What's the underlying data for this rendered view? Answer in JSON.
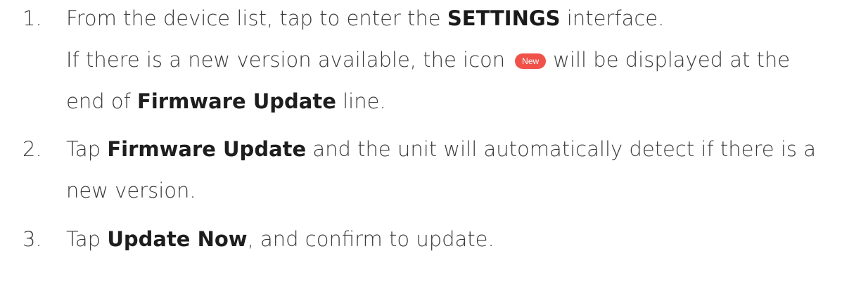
{
  "steps": [
    {
      "number": "1.",
      "lines": {
        "l1": {
          "a": "From the device list, tap to enter the ",
          "kw": "SETTINGS",
          "b": " interface."
        },
        "l2": {
          "a": "If there is a new version available, the icon",
          "badge": "New",
          "b": "will be displayed at the"
        },
        "l3": {
          "a": "end of ",
          "kw": "Firmware Update",
          "b": " line."
        }
      }
    },
    {
      "number": "2.",
      "lines": {
        "l1": {
          "a": "Tap ",
          "kw": "Firmware Update",
          "b": " and the unit will automatically detect if there is a"
        },
        "l2": {
          "a": "new version."
        }
      }
    },
    {
      "number": "3.",
      "lines": {
        "l1": {
          "a": "Tap ",
          "kw": "Update Now",
          "b": ", and confirm to update."
        }
      }
    }
  ],
  "colors": {
    "text": "#3a3a3a",
    "badge": "#f0524a"
  }
}
